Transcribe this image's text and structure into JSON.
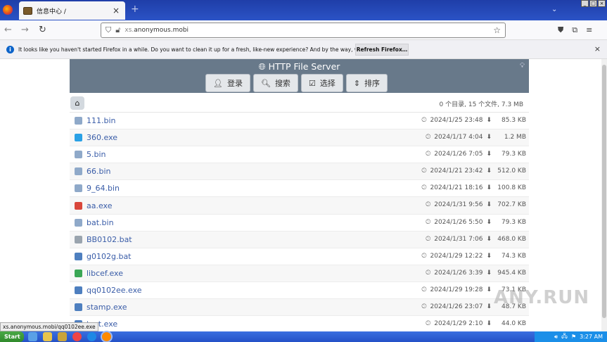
{
  "browser": {
    "tab_title": "信息中心 /",
    "tab_close": "×",
    "new_tab": "+",
    "url_host_prefix": "xs.",
    "url_host": "anonymous.mobi"
  },
  "notice": {
    "message": "It looks like you haven't started Firefox in a while. Do you want to clean it up for a fresh, like-new experience? And by the way, welcome back!",
    "button": "Refresh Firefox…",
    "close": "×"
  },
  "server": {
    "title": "HTTP File Server",
    "buttons": [
      {
        "label": "登录",
        "icon": "user-icon"
      },
      {
        "label": "搜索",
        "icon": "search-icon"
      },
      {
        "label": "选择",
        "icon": "check-icon"
      },
      {
        "label": "排序",
        "icon": "sort-icon"
      }
    ],
    "summary": "0 个目录, 15 个文件, 7.3 MB"
  },
  "files": [
    {
      "name": "111.bin",
      "date": "2024/1/25 23:48",
      "size": "85.3 KB",
      "icon_color": "#8fa9c9"
    },
    {
      "name": "360.exe",
      "date": "2024/1/17 4:04",
      "size": "1.2 MB",
      "icon_color": "#2aa1e6"
    },
    {
      "name": "5.bin",
      "date": "2024/1/26 7:05",
      "size": "79.3 KB",
      "icon_color": "#8fa9c9"
    },
    {
      "name": "66.bin",
      "date": "2024/1/21 23:42",
      "size": "512.0 KB",
      "icon_color": "#8fa9c9"
    },
    {
      "name": "9_64.bin",
      "date": "2024/1/21 18:16",
      "size": "100.8 KB",
      "icon_color": "#8fa9c9"
    },
    {
      "name": "aa.exe",
      "date": "2024/1/31 9:56",
      "size": "702.7 KB",
      "icon_color": "#d9473b"
    },
    {
      "name": "bat.bin",
      "date": "2024/1/26 5:50",
      "size": "79.3 KB",
      "icon_color": "#8fa9c9"
    },
    {
      "name": "BB0102.bat",
      "date": "2024/1/31 7:06",
      "size": "468.0 KB",
      "icon_color": "#9aa4ae"
    },
    {
      "name": "g0102g.bat",
      "date": "2024/1/29 12:22",
      "size": "74.3 KB",
      "icon_color": "#4e7fbf"
    },
    {
      "name": "libcef.exe",
      "date": "2024/1/26 3:39",
      "size": "945.4 KB",
      "icon_color": "#3aa655"
    },
    {
      "name": "qq0102ee.exe",
      "date": "2024/1/29 19:28",
      "size": "73.1 KB",
      "icon_color": "#4e7fbf"
    },
    {
      "name": "stamp.exe",
      "date": "2024/1/26 23:07",
      "size": "48.7 KB",
      "icon_color": "#4e7fbf"
    },
    {
      "name": "test.exe",
      "date": "2024/1/29 2:10",
      "size": "44.0 KB",
      "icon_color": "#4e7fbf"
    }
  ],
  "status_url": "xs.anonymous.mobi/qq0102ee.exe",
  "taskbar": {
    "start": "Start",
    "clock": "3:27 AM"
  },
  "watermark": "ANY.RUN"
}
